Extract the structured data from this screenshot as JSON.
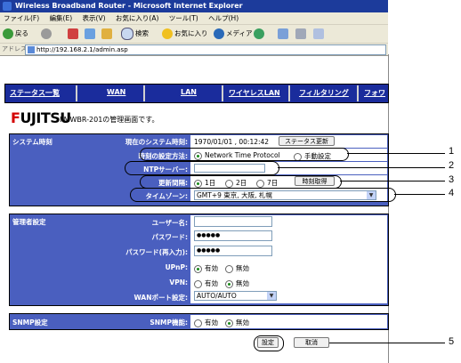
{
  "browser": {
    "title": "Wireless Broadband Router - Microsoft Internet Explorer",
    "menu": [
      "ファイル(F)",
      "編集(E)",
      "表示(V)",
      "お気に入り(A)",
      "ツール(T)",
      "ヘルプ(H)"
    ],
    "toolbar": {
      "back": "戻る",
      "search": "検索",
      "favorites": "お気に入り",
      "media": "メディア"
    },
    "address_label": "アドレス(D)",
    "url": "http://192.168.2.1/admin.asp"
  },
  "nav": [
    "ステータス一覧",
    "WAN",
    "LAN",
    "ワイヤレスLAN",
    "フィルタリング",
    "フォワ"
  ],
  "header": {
    "logo": "FUJITSU",
    "subtitle": "FMWBR-201の管理画面です。"
  },
  "system_time": {
    "heading": "システム時刻",
    "current_label": "現在のシステム時刻:",
    "current_value": "1970/01/01 , 00:12:42",
    "status_update_button": "ステータス更新",
    "method_label": "時刻の設定方法:",
    "method_options": [
      "Network Time Protocol",
      "手動設定"
    ],
    "ntp_label": "NTPサーバー:",
    "ntp_value": "",
    "interval_label": "更新間隔:",
    "interval_options": [
      "1日",
      "2日",
      "7日"
    ],
    "get_time_button": "時刻取得",
    "timezone_label": "タイムゾーン:",
    "timezone_value": "GMT+9 東京, 大阪, 札幌"
  },
  "admin": {
    "heading": "管理者設定",
    "username_label": "ユーザー名:",
    "username_value": "",
    "password_label": "パスワード:",
    "password_value": "●●●●●",
    "password_confirm_label": "パスワード(再入力):",
    "password_confirm_value": "●●●●●",
    "upnp_label": "UPnP:",
    "vpn_label": "VPN:",
    "enable": "有効",
    "disable": "無効",
    "wan_port_label": "WANポート設定:",
    "wan_port_value": "AUTO/AUTO"
  },
  "snmp": {
    "heading": "SNMP設定",
    "func_label": "SNMP機能:",
    "enable": "有効",
    "disable": "無効"
  },
  "footer": {
    "apply_button": "設定",
    "cancel_button": "取消"
  },
  "callouts": [
    "1",
    "2",
    "3",
    "4",
    "5"
  ]
}
